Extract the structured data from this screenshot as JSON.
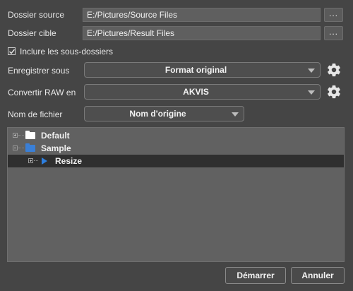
{
  "source": {
    "label": "Dossier source",
    "value": "E:/Pictures/Source Files",
    "browse_label": "..."
  },
  "target": {
    "label": "Dossier cible",
    "value": "E:/Pictures/Result Files",
    "browse_label": "..."
  },
  "include_subfolders": {
    "label": "Inclure les sous-dossiers",
    "checked": true
  },
  "save_as": {
    "label": "Enregistrer sous",
    "value": "Format original",
    "icon": "gear-icon"
  },
  "convert_raw": {
    "label": "Convertir RAW en",
    "value": "AKVIS",
    "icon": "gear-icon"
  },
  "filename": {
    "label": "Nom de fichier",
    "value": "Nom d'origine"
  },
  "tree": {
    "nodes": [
      {
        "label": "Default",
        "icon": "folder-icon",
        "color": "#ffffff",
        "expanded": false
      },
      {
        "label": "Sample",
        "icon": "folder-icon",
        "color": "#3a7fd6",
        "expanded": true
      },
      {
        "label": "Resize",
        "icon": "play-icon",
        "color": "#2d7fe0",
        "selected": true
      }
    ]
  },
  "buttons": {
    "start": "Démarrer",
    "cancel": "Annuler"
  }
}
